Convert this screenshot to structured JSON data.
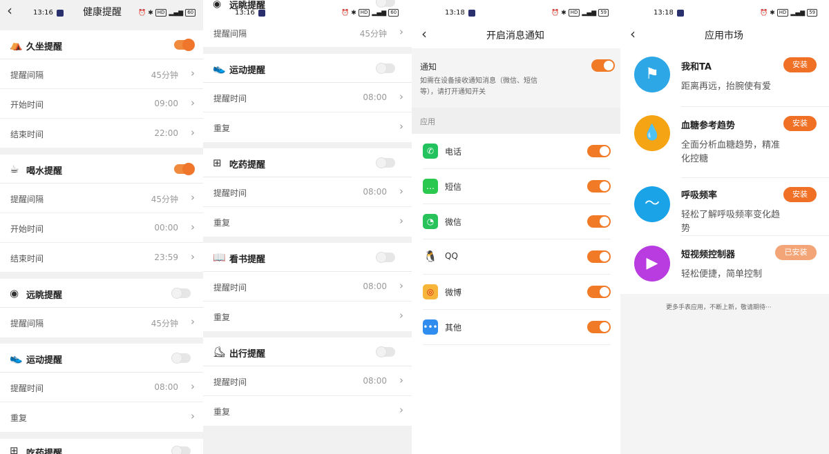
{
  "status": {
    "p1_time": "13:16",
    "p2_time": "13:16",
    "p3_time": "13:18",
    "p4_time": "13:18",
    "battery_p12": "60",
    "battery_p34": "59"
  },
  "panel1": {
    "title": "健康提醒",
    "sedentary": {
      "title": "久坐提醒",
      "interval_label": "提醒间隔",
      "interval_value": "45分钟",
      "start_label": "开始时间",
      "start_value": "09:00",
      "end_label": "结束时间",
      "end_value": "22:00"
    },
    "water": {
      "title": "喝水提醒",
      "interval_label": "提醒间隔",
      "interval_value": "45分钟",
      "start_label": "开始时间",
      "start_value": "00:00",
      "end_label": "结束时间",
      "end_value": "23:59"
    },
    "eye": {
      "title": "远眺提醒",
      "interval_label": "提醒间隔",
      "interval_value": "45分钟"
    },
    "sport": {
      "title": "运动提醒",
      "time_label": "提醒时间",
      "time_value": "08:00",
      "repeat_label": "重复"
    },
    "medicine": {
      "title": "吃药提醒"
    }
  },
  "panel2": {
    "eye": {
      "title": "远眺提醒",
      "interval_label": "提醒间隔",
      "interval_value": "45分钟"
    },
    "sport": {
      "title": "运动提醒",
      "time_label": "提醒时间",
      "time_value": "08:00",
      "repeat_label": "重复"
    },
    "medicine": {
      "title": "吃药提醒",
      "time_label": "提醒时间",
      "time_value": "08:00",
      "repeat_label": "重复"
    },
    "reading": {
      "title": "看书提醒",
      "time_label": "提醒时间",
      "time_value": "08:00",
      "repeat_label": "重复"
    },
    "travel": {
      "title": "出行提醒",
      "time_label": "提醒时间",
      "time_value": "08:00",
      "repeat_label": "重复"
    }
  },
  "panel3": {
    "title": "开启消息通知",
    "notify_title": "通知",
    "notify_desc_1": "如需在设备接收通知消息（微信、短信",
    "notify_desc_2": "等），请打开通知开关",
    "apps_header": "应用",
    "apps": [
      "电话",
      "短信",
      "微信",
      "QQ",
      "微博",
      "其他"
    ]
  },
  "panel4": {
    "title": "应用市场",
    "items": [
      {
        "name": "我和TA",
        "desc": "距离再远，抬腕使有爱",
        "btn": "安装"
      },
      {
        "name": "血糖参考趋势",
        "desc": "全面分析血糖趋势，精准化控糖",
        "btn": "安装"
      },
      {
        "name": "呼吸频率",
        "desc": "轻松了解呼吸频率变化趋势",
        "btn": "安装"
      },
      {
        "name": "短视频控制器",
        "desc": "轻松便捷，简单控制",
        "btn": "已安装"
      }
    ],
    "footer": "更多手表应用，不断上新，敬请期待···"
  },
  "colors": {
    "accent": "#f07026",
    "toggle_off": "#e6e6e6"
  },
  "icons": {
    "sedentary": "chair-icon",
    "water": "cup-icon",
    "eye": "eye-icon",
    "sport": "shoe-icon",
    "medicine": "medicine-box-icon",
    "reading": "book-icon",
    "travel": "sneaker-icon"
  }
}
